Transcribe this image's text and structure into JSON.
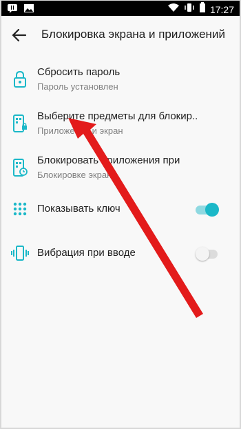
{
  "status_bar": {
    "time": "17:27",
    "icons": [
      "notification-icon",
      "image-icon",
      "wifi-icon",
      "vibrate-icon",
      "battery-icon"
    ]
  },
  "app_bar": {
    "title": "Блокировка экрана и приложений",
    "back_icon": "arrow-left-icon"
  },
  "settings": [
    {
      "icon": "lock-icon",
      "primary": "Сбросить пароль",
      "secondary": "Пароль установлен"
    },
    {
      "icon": "phone-lock-icon",
      "primary": "Выберите предметы для блокир..",
      "secondary": "Приложения и экран"
    },
    {
      "icon": "phone-timer-icon",
      "primary": "Блокировать приложения при",
      "secondary": "Блокировке экрана"
    },
    {
      "icon": "dots-grid-icon",
      "primary": "Показывать ключ",
      "toggle": true
    },
    {
      "icon": "vibrate-icon",
      "primary": "Вибрация при вводе",
      "toggle": false
    }
  ],
  "colors": {
    "accent": "#1bb8c8",
    "toggle_on_track": "#8fd9e1",
    "toggle_off_track": "#dcdcdc",
    "toggle_off_thumb": "#f4f4f4",
    "arrow": "#e31b1b"
  }
}
